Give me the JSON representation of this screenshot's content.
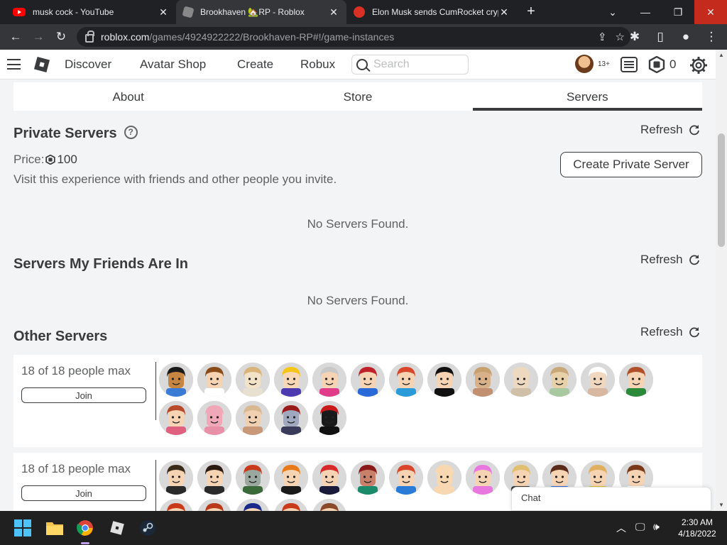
{
  "browser": {
    "tabs": [
      {
        "title": "musk cock - YouTube",
        "icon": "youtube-icon",
        "active": false
      },
      {
        "title": "Brookhaven 🏡RP - Roblox",
        "icon": "roblox-icon",
        "active": true
      },
      {
        "title": "Elon Musk sends CumRocket cryp",
        "icon": "cumrocket-icon",
        "active": false
      }
    ],
    "url_host": "roblox.com",
    "url_path": "/games/4924922222/Brookhaven-RP#!/game-instances"
  },
  "nav": {
    "links": [
      "Discover",
      "Avatar Shop",
      "Create",
      "Robux"
    ],
    "search_placeholder": "Search",
    "age_badge": "13+",
    "robux_balance": "0"
  },
  "game_tabs": [
    {
      "label": "About",
      "active": false
    },
    {
      "label": "Store",
      "active": false
    },
    {
      "label": "Servers",
      "active": true
    }
  ],
  "private_servers": {
    "title": "Private Servers",
    "help": "?",
    "refresh_label": "Refresh",
    "price_label": "Price:",
    "price_value": "100",
    "description": "Visit this experience with friends and other people you invite.",
    "create_button": "Create Private Server",
    "empty_text": "No Servers Found."
  },
  "friends_servers": {
    "title": "Servers My Friends Are In",
    "refresh_label": "Refresh",
    "empty_text": "No Servers Found."
  },
  "other_servers": {
    "title": "Other Servers",
    "refresh_label": "Refresh",
    "servers": [
      {
        "count": "18 of 18 people max",
        "join_label": "Join",
        "players": [
          {
            "skin": "#c68642",
            "hair": "#1a1a1a",
            "shirt": "#3a7bd5"
          },
          {
            "skin": "#f6d3b3",
            "hair": "#8a4b1a",
            "shirt": "#ffffff"
          },
          {
            "skin": "#f2e2c8",
            "hair": "#d9b37a",
            "shirt": "#e8e0d0"
          },
          {
            "skin": "#f7d7b5",
            "hair": "#f5c518",
            "shirt": "#4c3ab0"
          },
          {
            "skin": "#f6d3b3",
            "hair": "#c8c8c8",
            "shirt": "#e03c8a"
          },
          {
            "skin": "#f6d3b3",
            "hair": "#c0202a",
            "shirt": "#2a6ad8"
          },
          {
            "skin": "#f6d3b3",
            "hair": "#d8472a",
            "shirt": "#2a9ad8"
          },
          {
            "skin": "#f6d3b3",
            "hair": "#111111",
            "shirt": "#111111"
          },
          {
            "skin": "#d8b08a",
            "hair": "#c8a070",
            "shirt": "#c09070"
          },
          {
            "skin": "#ecd9c0",
            "hair": "#ecd9c0",
            "shirt": "#d0c0a8"
          },
          {
            "skin": "#e8d0a8",
            "hair": "#c8a878",
            "shirt": "#a8c8a0"
          },
          {
            "skin": "#f0d8c0",
            "hair": "#ffffff",
            "shirt": "#d8b8a0"
          },
          {
            "skin": "#f6d3b3",
            "hair": "#b0502a",
            "shirt": "#2a8a3a"
          },
          {
            "skin": "#f6d3b3",
            "hair": "#b84a2a",
            "shirt": "#e06080"
          },
          {
            "skin": "#f0a8b8",
            "hair": "#f0a8b8",
            "shirt": "#e890a8"
          },
          {
            "skin": "#f0d0b0",
            "hair": "#d8b890",
            "shirt": "#c89878"
          },
          {
            "skin": "#a0a8c0",
            "hair": "#9a1a1a",
            "shirt": "#3a3a5a"
          },
          {
            "skin": "#1a1a1a",
            "hair": "#c81a1a",
            "shirt": "#111111"
          }
        ]
      },
      {
        "count": "18 of 18 people max",
        "join_label": "Join",
        "players": [
          {
            "skin": "#f6d3b3",
            "hair": "#3a2a1a",
            "shirt": "#2a2a2a"
          },
          {
            "skin": "#f6d3b3",
            "hair": "#2a1a10",
            "shirt": "#2a2a2a"
          },
          {
            "skin": "#9aa8a0",
            "hair": "#c83a1a",
            "shirt": "#3a6a3a"
          },
          {
            "skin": "#f6d3b3",
            "hair": "#e87a1a",
            "shirt": "#1a1a1a"
          },
          {
            "skin": "#f6d3b3",
            "hair": "#d82a2a",
            "shirt": "#1a1a3a"
          },
          {
            "skin": "#c8806a",
            "hair": "#8a1a1a",
            "shirt": "#1a8a6a"
          },
          {
            "skin": "#f6d3b3",
            "hair": "#d8472a",
            "shirt": "#2a7ad8"
          },
          {
            "skin": "#f8d8b0",
            "hair": "#f8d8b0",
            "shirt": "#f8d8b0"
          },
          {
            "skin": "#f6d3b3",
            "hair": "#e878e0",
            "shirt": "#e878e0"
          },
          {
            "skin": "#f6d3b3",
            "hair": "#e0c070",
            "shirt": "#3a3a3a"
          },
          {
            "skin": "#f6d3b3",
            "hair": "#5a2a1a",
            "shirt": "#2a6ad8"
          },
          {
            "skin": "#f6d3b3",
            "hair": "#e0b060",
            "shirt": "#d8c030"
          },
          {
            "skin": "#f6d3b3",
            "hair": "#7a3a1a",
            "shirt": "#ffffff"
          },
          {
            "skin": "#f6d3b3",
            "hair": "#c83a1a",
            "shirt": "#c83a1a"
          },
          {
            "skin": "#f6d3b3",
            "hair": "#b83a1a",
            "shirt": "#c83a1a"
          },
          {
            "skin": "#f6d3b3",
            "hair": "#1a2a8a",
            "shirt": "#1a2a8a"
          },
          {
            "skin": "#f6d3b3",
            "hair": "#c83a1a",
            "shirt": "#c83a1a"
          },
          {
            "skin": "#f6d3b3",
            "hair": "#8a4a2a",
            "shirt": "#8a4a2a"
          }
        ]
      }
    ]
  },
  "chat_label": "Chat",
  "taskbar": {
    "time": "2:30 AM",
    "date": "4/18/2022"
  }
}
